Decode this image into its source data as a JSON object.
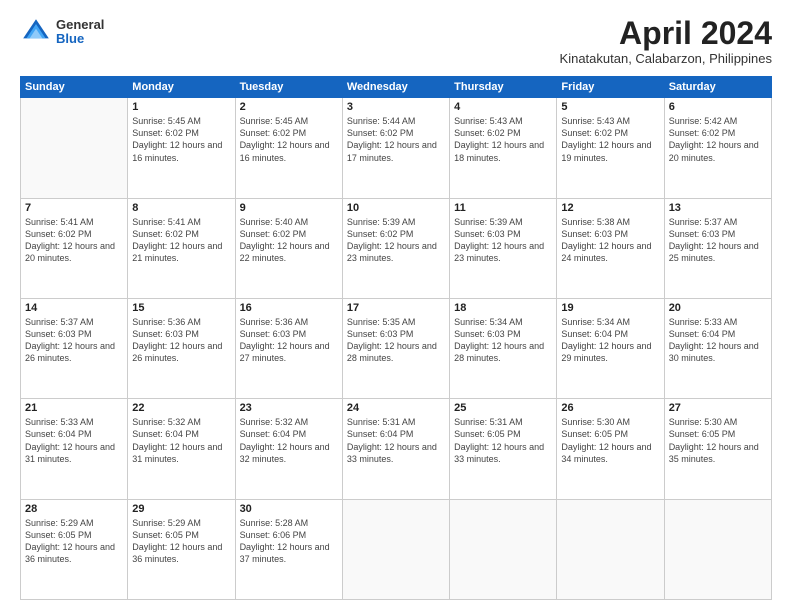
{
  "header": {
    "logo": {
      "general": "General",
      "blue": "Blue"
    },
    "title": "April 2024",
    "location": "Kinatakutan, Calabarzon, Philippines"
  },
  "weekdays": [
    "Sunday",
    "Monday",
    "Tuesday",
    "Wednesday",
    "Thursday",
    "Friday",
    "Saturday"
  ],
  "weeks": [
    [
      {
        "day": "",
        "empty": true
      },
      {
        "day": "1",
        "sunrise": "Sunrise: 5:45 AM",
        "sunset": "Sunset: 6:02 PM",
        "daylight": "Daylight: 12 hours and 16 minutes."
      },
      {
        "day": "2",
        "sunrise": "Sunrise: 5:45 AM",
        "sunset": "Sunset: 6:02 PM",
        "daylight": "Daylight: 12 hours and 16 minutes."
      },
      {
        "day": "3",
        "sunrise": "Sunrise: 5:44 AM",
        "sunset": "Sunset: 6:02 PM",
        "daylight": "Daylight: 12 hours and 17 minutes."
      },
      {
        "day": "4",
        "sunrise": "Sunrise: 5:43 AM",
        "sunset": "Sunset: 6:02 PM",
        "daylight": "Daylight: 12 hours and 18 minutes."
      },
      {
        "day": "5",
        "sunrise": "Sunrise: 5:43 AM",
        "sunset": "Sunset: 6:02 PM",
        "daylight": "Daylight: 12 hours and 19 minutes."
      },
      {
        "day": "6",
        "sunrise": "Sunrise: 5:42 AM",
        "sunset": "Sunset: 6:02 PM",
        "daylight": "Daylight: 12 hours and 20 minutes."
      }
    ],
    [
      {
        "day": "7",
        "sunrise": "Sunrise: 5:41 AM",
        "sunset": "Sunset: 6:02 PM",
        "daylight": "Daylight: 12 hours and 20 minutes."
      },
      {
        "day": "8",
        "sunrise": "Sunrise: 5:41 AM",
        "sunset": "Sunset: 6:02 PM",
        "daylight": "Daylight: 12 hours and 21 minutes."
      },
      {
        "day": "9",
        "sunrise": "Sunrise: 5:40 AM",
        "sunset": "Sunset: 6:02 PM",
        "daylight": "Daylight: 12 hours and 22 minutes."
      },
      {
        "day": "10",
        "sunrise": "Sunrise: 5:39 AM",
        "sunset": "Sunset: 6:02 PM",
        "daylight": "Daylight: 12 hours and 23 minutes."
      },
      {
        "day": "11",
        "sunrise": "Sunrise: 5:39 AM",
        "sunset": "Sunset: 6:03 PM",
        "daylight": "Daylight: 12 hours and 23 minutes."
      },
      {
        "day": "12",
        "sunrise": "Sunrise: 5:38 AM",
        "sunset": "Sunset: 6:03 PM",
        "daylight": "Daylight: 12 hours and 24 minutes."
      },
      {
        "day": "13",
        "sunrise": "Sunrise: 5:37 AM",
        "sunset": "Sunset: 6:03 PM",
        "daylight": "Daylight: 12 hours and 25 minutes."
      }
    ],
    [
      {
        "day": "14",
        "sunrise": "Sunrise: 5:37 AM",
        "sunset": "Sunset: 6:03 PM",
        "daylight": "Daylight: 12 hours and 26 minutes."
      },
      {
        "day": "15",
        "sunrise": "Sunrise: 5:36 AM",
        "sunset": "Sunset: 6:03 PM",
        "daylight": "Daylight: 12 hours and 26 minutes."
      },
      {
        "day": "16",
        "sunrise": "Sunrise: 5:36 AM",
        "sunset": "Sunset: 6:03 PM",
        "daylight": "Daylight: 12 hours and 27 minutes."
      },
      {
        "day": "17",
        "sunrise": "Sunrise: 5:35 AM",
        "sunset": "Sunset: 6:03 PM",
        "daylight": "Daylight: 12 hours and 28 minutes."
      },
      {
        "day": "18",
        "sunrise": "Sunrise: 5:34 AM",
        "sunset": "Sunset: 6:03 PM",
        "daylight": "Daylight: 12 hours and 28 minutes."
      },
      {
        "day": "19",
        "sunrise": "Sunrise: 5:34 AM",
        "sunset": "Sunset: 6:04 PM",
        "daylight": "Daylight: 12 hours and 29 minutes."
      },
      {
        "day": "20",
        "sunrise": "Sunrise: 5:33 AM",
        "sunset": "Sunset: 6:04 PM",
        "daylight": "Daylight: 12 hours and 30 minutes."
      }
    ],
    [
      {
        "day": "21",
        "sunrise": "Sunrise: 5:33 AM",
        "sunset": "Sunset: 6:04 PM",
        "daylight": "Daylight: 12 hours and 31 minutes."
      },
      {
        "day": "22",
        "sunrise": "Sunrise: 5:32 AM",
        "sunset": "Sunset: 6:04 PM",
        "daylight": "Daylight: 12 hours and 31 minutes."
      },
      {
        "day": "23",
        "sunrise": "Sunrise: 5:32 AM",
        "sunset": "Sunset: 6:04 PM",
        "daylight": "Daylight: 12 hours and 32 minutes."
      },
      {
        "day": "24",
        "sunrise": "Sunrise: 5:31 AM",
        "sunset": "Sunset: 6:04 PM",
        "daylight": "Daylight: 12 hours and 33 minutes."
      },
      {
        "day": "25",
        "sunrise": "Sunrise: 5:31 AM",
        "sunset": "Sunset: 6:05 PM",
        "daylight": "Daylight: 12 hours and 33 minutes."
      },
      {
        "day": "26",
        "sunrise": "Sunrise: 5:30 AM",
        "sunset": "Sunset: 6:05 PM",
        "daylight": "Daylight: 12 hours and 34 minutes."
      },
      {
        "day": "27",
        "sunrise": "Sunrise: 5:30 AM",
        "sunset": "Sunset: 6:05 PM",
        "daylight": "Daylight: 12 hours and 35 minutes."
      }
    ],
    [
      {
        "day": "28",
        "sunrise": "Sunrise: 5:29 AM",
        "sunset": "Sunset: 6:05 PM",
        "daylight": "Daylight: 12 hours and 36 minutes."
      },
      {
        "day": "29",
        "sunrise": "Sunrise: 5:29 AM",
        "sunset": "Sunset: 6:05 PM",
        "daylight": "Daylight: 12 hours and 36 minutes."
      },
      {
        "day": "30",
        "sunrise": "Sunrise: 5:28 AM",
        "sunset": "Sunset: 6:06 PM",
        "daylight": "Daylight: 12 hours and 37 minutes."
      },
      {
        "day": "",
        "empty": true
      },
      {
        "day": "",
        "empty": true
      },
      {
        "day": "",
        "empty": true
      },
      {
        "day": "",
        "empty": true
      }
    ]
  ]
}
